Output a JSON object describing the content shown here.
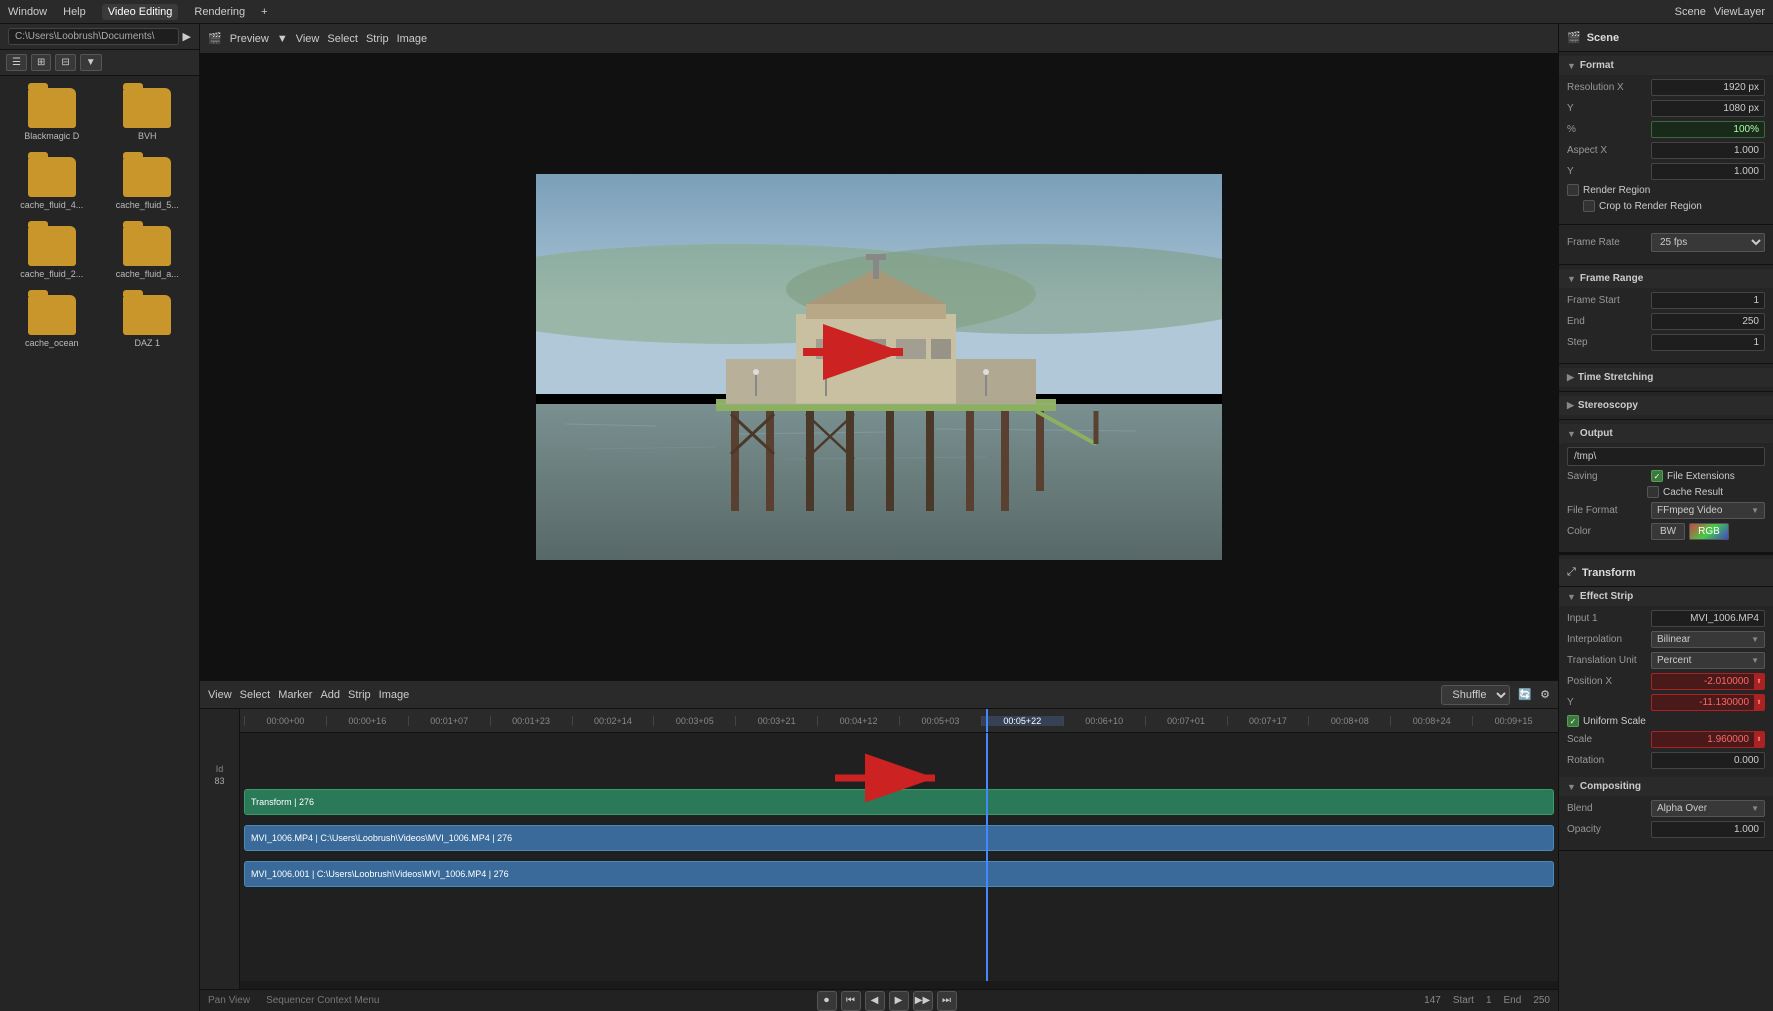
{
  "app": {
    "title": "Blender Video Editing",
    "top_menu": [
      "Window",
      "Help",
      "Video Editing",
      "Rendering"
    ],
    "active_menu": "Video Editing",
    "add_btn": "+"
  },
  "header": {
    "workspace": "Scene",
    "view_layer": "ViewLayer"
  },
  "preview": {
    "mode": "Preview",
    "menus": [
      "View",
      "Select",
      "Strip",
      "Image"
    ]
  },
  "file_browser": {
    "path": "C:\\Users\\Loobrush\\Documents\\",
    "items": [
      {
        "name": "Blackmagic D",
        "type": "folder"
      },
      {
        "name": "BVH",
        "type": "folder"
      },
      {
        "name": "cache_fluid_4...",
        "type": "folder"
      },
      {
        "name": "cache_fluid_5...",
        "type": "folder"
      },
      {
        "name": "cache_fluid_2...",
        "type": "folder"
      },
      {
        "name": "cache_fluid_a...",
        "type": "folder"
      },
      {
        "name": "cache_ocean",
        "type": "folder"
      },
      {
        "name": "DAZ 1",
        "type": "folder"
      }
    ]
  },
  "sequencer": {
    "menus": [
      "View",
      "Select",
      "Marker",
      "Add",
      "Strip",
      "Image"
    ],
    "playback_mode": "Shuffle",
    "ruler_marks": [
      "00:00+00",
      "00:00+16",
      "00:01+07",
      "00:01+23",
      "00:02+14",
      "00:03+05",
      "00:03+21",
      "00:04+12",
      "00:05+03",
      "00:05+22",
      "00:06+10",
      "00:07+01",
      "00:07+17",
      "00:08+08",
      "00:08+24",
      "00:09+15"
    ],
    "active_mark": "00:05+22",
    "tracks": [
      {
        "id": "83",
        "name": "Transform | 276",
        "type": "transform",
        "color": "#2a7a5a"
      },
      {
        "name": "MVI_1006.MP4 | C:\\Users\\Loobrush\\Videos\\MVI_1006.MP4 | 276",
        "type": "video",
        "color": "#3a6a9a"
      },
      {
        "name": "MVI_1006.001 | C:\\Users\\Loobrush\\Videos\\MVI_1006.MP4 | 276",
        "type": "video",
        "color": "#3a6a9a"
      }
    ]
  },
  "playback": {
    "frame_current": "147",
    "frame_start": "1",
    "frame_end": "250"
  },
  "properties": {
    "panel_title": "Scene",
    "format_section": "Format",
    "resolution_x": "1920 px",
    "resolution_y": "1080 px",
    "resolution_percent": "100%",
    "aspect_x_label": "Aspect X",
    "aspect_x": "1.000",
    "aspect_y": "1.000",
    "render_region": "Render Region",
    "crop_label": "Crop to Render Region",
    "frame_rate_label": "Frame Rate",
    "frame_rate": "25 fps",
    "frame_range_section": "Frame Range",
    "frame_start_label": "Frame Start",
    "frame_start": "1",
    "frame_end_label": "End",
    "frame_end": "250",
    "frame_step_label": "Step",
    "frame_step": "1",
    "time_stretching": "Time Stretching",
    "stereoscopy": "Stereoscopy",
    "output_section": "Output",
    "output_path": "/tmp\\",
    "saving_label": "Saving",
    "file_extensions_label": "File Extensions",
    "file_extensions_checked": true,
    "cache_result_label": "Cache Result",
    "cache_result_checked": false,
    "file_format_label": "File Format",
    "file_format": "FFmpeg Video",
    "color_label": "Color",
    "color_value": "BW",
    "rgb_value": "RGB"
  },
  "transform_panel": {
    "title": "Transform",
    "effect_strip": "Effect Strip",
    "input_1_label": "Input 1",
    "input_1": "MVI_1006.MP4",
    "interpolation_label": "Interpolation",
    "interpolation": "Bilinear",
    "translation_unit_label": "Translation Unit",
    "translation_unit": "Percent",
    "position_x_label": "Position X",
    "position_x": "-2.010000",
    "position_y_label": "Y",
    "position_y": "-11.130000",
    "uniform_scale_label": "Uniform Scale",
    "uniform_scale_checked": true,
    "scale_label": "Scale",
    "scale_value": "1.960000",
    "rotation_label": "Rotation",
    "rotation_value": "0.000",
    "compositing_label": "Compositing",
    "blend_label": "Blend",
    "blend_value": "Alpha Over",
    "opacity_label": "Opacity",
    "opacity_value": "1.000"
  },
  "bottom_info": {
    "pan_view": "Pan View",
    "sequencer_context": "Sequencer Context Menu"
  }
}
